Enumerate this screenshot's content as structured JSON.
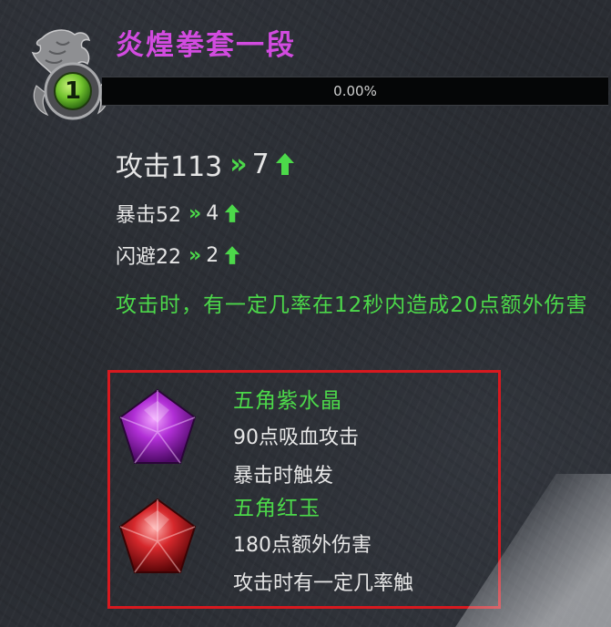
{
  "item": {
    "name": "炎煌拳套一段",
    "level": "1",
    "progress_text": "0.00%",
    "progress_fraction": 0
  },
  "stats": [
    {
      "label": "攻击113",
      "increase": "7",
      "chevrons": "»",
      "size": "large"
    },
    {
      "label": "暴击52",
      "increase": "4",
      "chevrons": "»",
      "size": "small"
    },
    {
      "label": "闪避22",
      "increase": "2",
      "chevrons": "»",
      "size": "small"
    }
  ],
  "effect_description": "攻击时，有一定几率在12秒内造成20点额外伤害",
  "gems": [
    {
      "name": "五角紫水晶",
      "effect": "90点吸血攻击",
      "trigger": "暴击时触发",
      "color": "#b12fd6",
      "icon": "purple-pentagon-gem"
    },
    {
      "name": "五角红玉",
      "effect": "180点额外伤害",
      "trigger": "攻击时有一定几率触",
      "color": "#d6282c",
      "icon": "red-pentagon-gem"
    }
  ],
  "colors": {
    "title": "#d24be0",
    "bonus_green": "#4cd94a",
    "highlight_frame": "#d7191f"
  }
}
